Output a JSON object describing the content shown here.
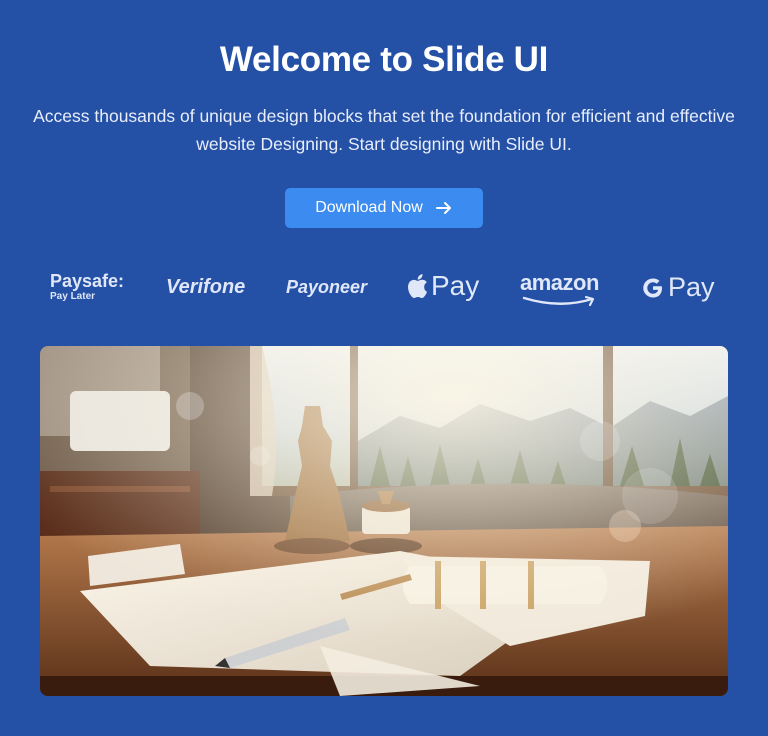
{
  "header": {
    "title": "Welcome to Slide UI",
    "subtitle": "Access thousands of unique design blocks that set the foundation for efficient and effective website Designing. Start designing with Slide UI."
  },
  "cta": {
    "label": "Download Now",
    "icon": "arrow-right-icon"
  },
  "logos": [
    {
      "name": "Paysafe:",
      "sub": "Pay Later"
    },
    {
      "name": "Verifone"
    },
    {
      "name": "Payoneer"
    },
    {
      "name": "Pay",
      "icon": "apple-icon"
    },
    {
      "name": "amazon"
    },
    {
      "name": "Pay",
      "icon": "google-g-icon"
    }
  ],
  "colors": {
    "background": "#2450a6",
    "button": "#3b8bf0",
    "text": "#ffffff"
  }
}
